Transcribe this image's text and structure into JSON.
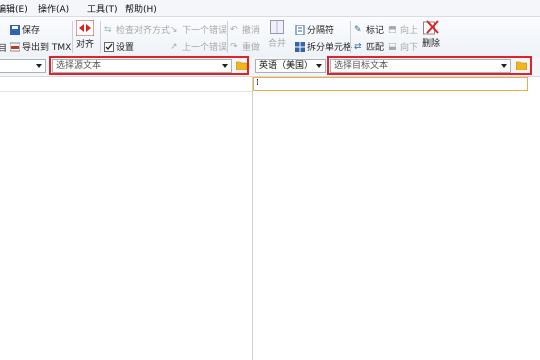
{
  "menu": [
    "编辑(E)",
    "操作(A)",
    "工具(T)",
    "帮助(H)"
  ],
  "toolbar": {
    "file_label": "目",
    "save": "保存",
    "export_tmx": "导出到 TMX",
    "align": "对齐",
    "check_alignment": "检查对齐方式",
    "settings": "设置",
    "next_error": "下一个错误",
    "prev_error": "上一个错误",
    "undo": "撤消",
    "redo": "重做",
    "merge": "合并",
    "separator": "分隔符",
    "split_cell": "拆分单元格",
    "mark": "标记",
    "match": "匹配",
    "up": "向上",
    "down": "向下",
    "delete": "删除"
  },
  "source": {
    "language": "",
    "file_placeholder": "选择源文本"
  },
  "target": {
    "language": "英语（美国）",
    "file_placeholder": "选择目标文本"
  },
  "colors": {
    "highlight_box": "#e0232b",
    "active_row_border": "#f0a84a"
  }
}
